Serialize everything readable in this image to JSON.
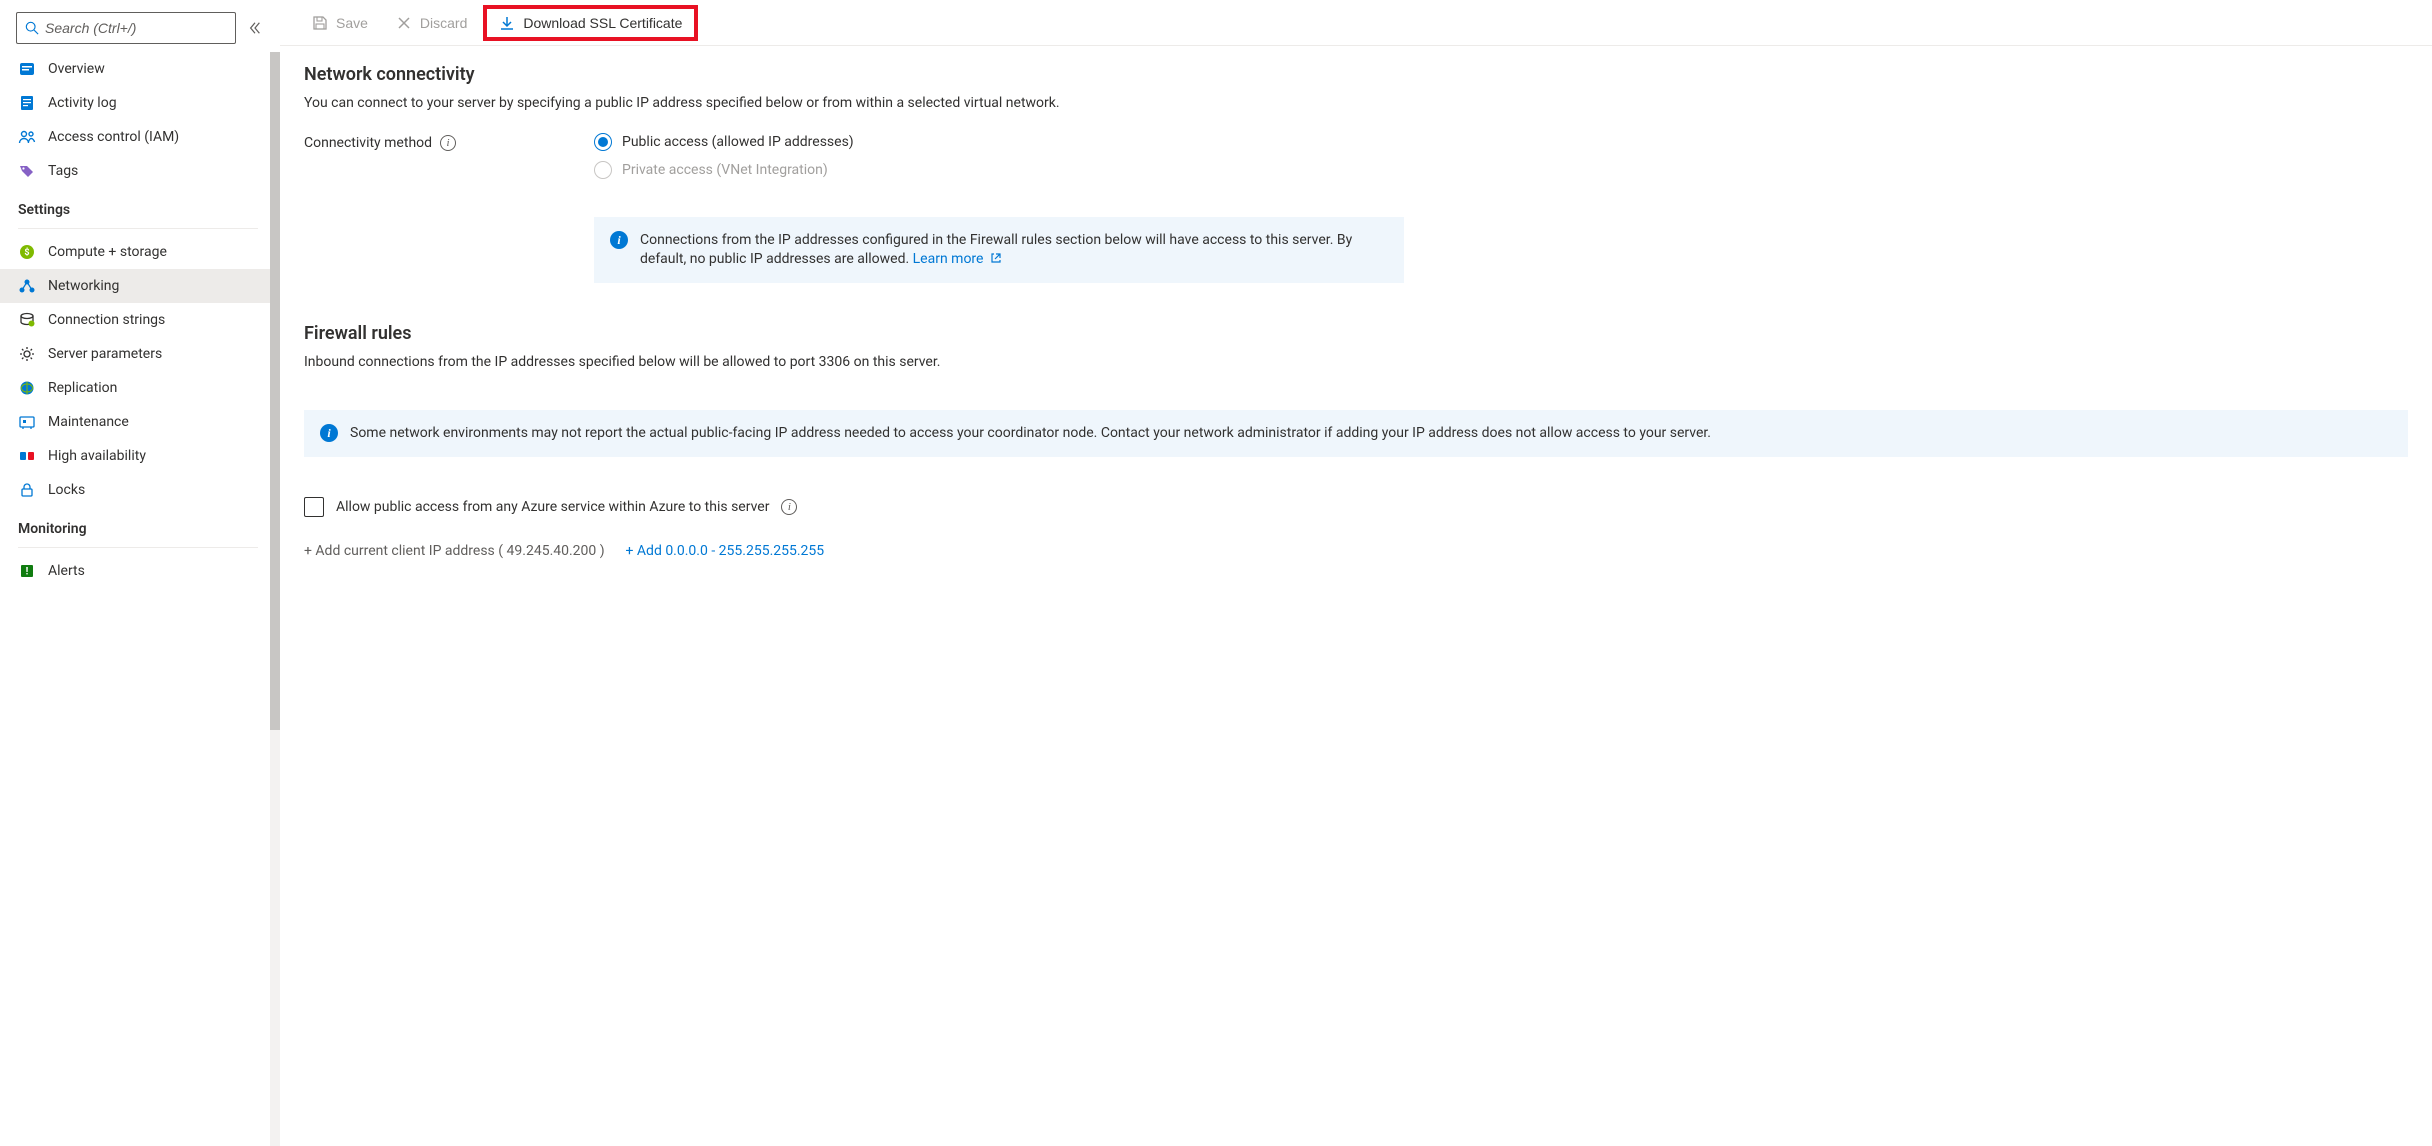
{
  "sidebar": {
    "search_placeholder": "Search (Ctrl+/)",
    "top_items": [
      {
        "key": "overview",
        "label": "Overview"
      },
      {
        "key": "activity-log",
        "label": "Activity log"
      },
      {
        "key": "access-control",
        "label": "Access control (IAM)"
      },
      {
        "key": "tags",
        "label": "Tags"
      }
    ],
    "settings_header": "Settings",
    "settings_items": [
      {
        "key": "compute-storage",
        "label": "Compute + storage"
      },
      {
        "key": "networking",
        "label": "Networking",
        "selected": true
      },
      {
        "key": "connection-strings",
        "label": "Connection strings"
      },
      {
        "key": "server-parameters",
        "label": "Server parameters"
      },
      {
        "key": "replication",
        "label": "Replication"
      },
      {
        "key": "maintenance",
        "label": "Maintenance"
      },
      {
        "key": "high-availability",
        "label": "High availability"
      },
      {
        "key": "locks",
        "label": "Locks"
      }
    ],
    "monitoring_header": "Monitoring",
    "monitoring_items": [
      {
        "key": "alerts",
        "label": "Alerts"
      }
    ]
  },
  "toolbar": {
    "save_label": "Save",
    "discard_label": "Discard",
    "download_label": "Download SSL Certificate"
  },
  "content": {
    "network_heading": "Network connectivity",
    "network_body": "You can connect to your server by specifying a public IP address specified below or from within a selected virtual network.",
    "connectivity_label": "Connectivity method",
    "radio_public": "Public access (allowed IP addresses)",
    "radio_private": "Private access (VNet Integration)",
    "info1_text": "Connections from the IP addresses configured in the Firewall rules section below will have access to this server. By default, no public IP addresses are allowed. ",
    "info1_link": "Learn more",
    "firewall_heading": "Firewall rules",
    "firewall_body": "Inbound connections from the IP addresses specified below will be allowed to port 3306 on this server.",
    "info2_text": "Some network environments may not report the actual public-facing IP address needed to access your coordinator node. Contact your network administrator if adding your IP address does not allow access to your server.",
    "allow_azure_label": "Allow public access from any Azure service within Azure to this server",
    "add_client_ip_prefix": "+ Add current client IP address",
    "client_ip": "( 49.245.40.200 )",
    "add_range_link": "+ Add 0.0.0.0 - 255.255.255.255"
  }
}
